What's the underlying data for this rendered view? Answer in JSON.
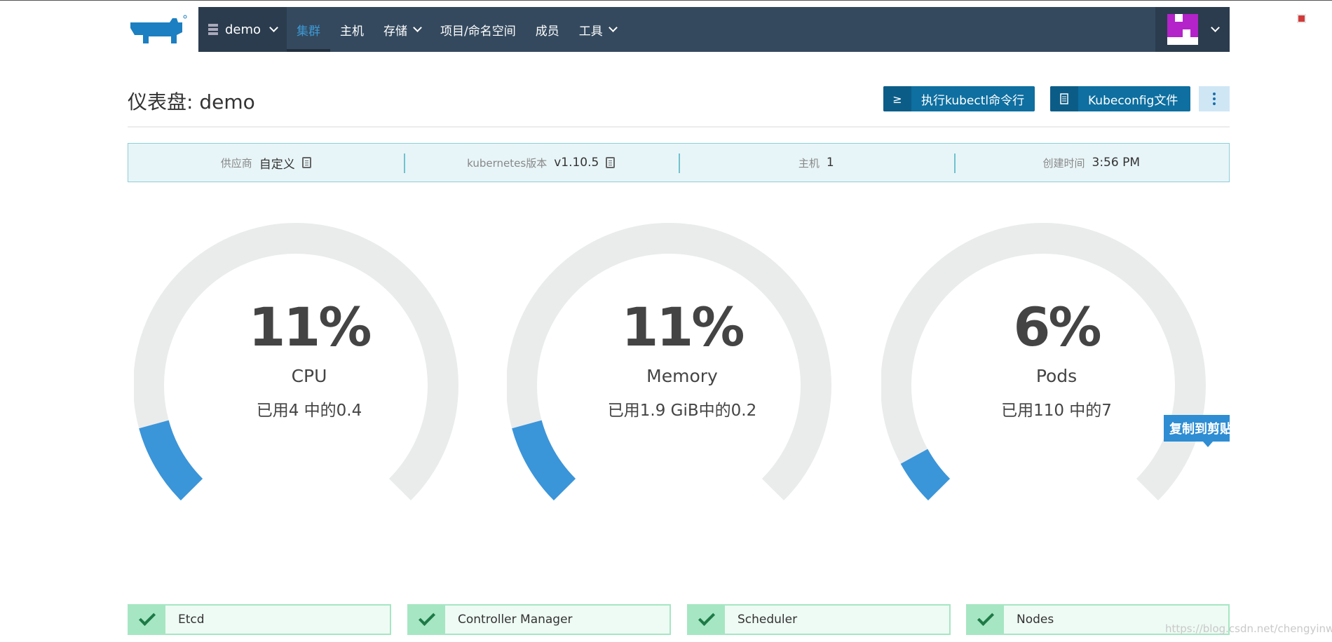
{
  "nav": {
    "cluster_name": "demo",
    "items": [
      {
        "label": "集群",
        "dropdown": false,
        "active": true
      },
      {
        "label": "主机",
        "dropdown": false,
        "active": false
      },
      {
        "label": "存储",
        "dropdown": true,
        "active": false
      },
      {
        "label": "项目/命名空间",
        "dropdown": false,
        "active": false
      },
      {
        "label": "成员",
        "dropdown": false,
        "active": false
      },
      {
        "label": "工具",
        "dropdown": true,
        "active": false
      }
    ]
  },
  "page": {
    "title": "仪表盘: demo",
    "kubectl_button": "执行kubectl命令行",
    "kubeconfig_button": "Kubeconfig文件"
  },
  "info": {
    "provider_label": "供应商",
    "provider_value": "自定义",
    "k8s_label": "kubernetes版本",
    "k8s_value": "v1.10.5",
    "hosts_label": "主机",
    "hosts_value": "1",
    "created_label": "创建时间",
    "created_value": "3:56 PM"
  },
  "gauges": [
    {
      "percent": "11%",
      "name": "CPU",
      "detail": "已用4 中的0.4",
      "fraction": 0.11
    },
    {
      "percent": "11%",
      "name": "Memory",
      "detail": "已用1.9 GiB中的0.2",
      "fraction": 0.11
    },
    {
      "percent": "6%",
      "name": "Pods",
      "detail": "已用110 中的7",
      "fraction": 0.06
    }
  ],
  "tooltip": "复制到剪贴板",
  "status": [
    {
      "name": "Etcd"
    },
    {
      "name": "Controller Manager"
    },
    {
      "name": "Scheduler"
    },
    {
      "name": "Nodes"
    }
  ],
  "watermark": "https://blog.csdn.net/chengyinwu",
  "colors": {
    "nav_bg": "#34495e",
    "accent": "#3d98d3",
    "gauge_track": "#eaecec",
    "gauge_fill": "#3b95d9",
    "status_ok": "#a6e6c3"
  }
}
